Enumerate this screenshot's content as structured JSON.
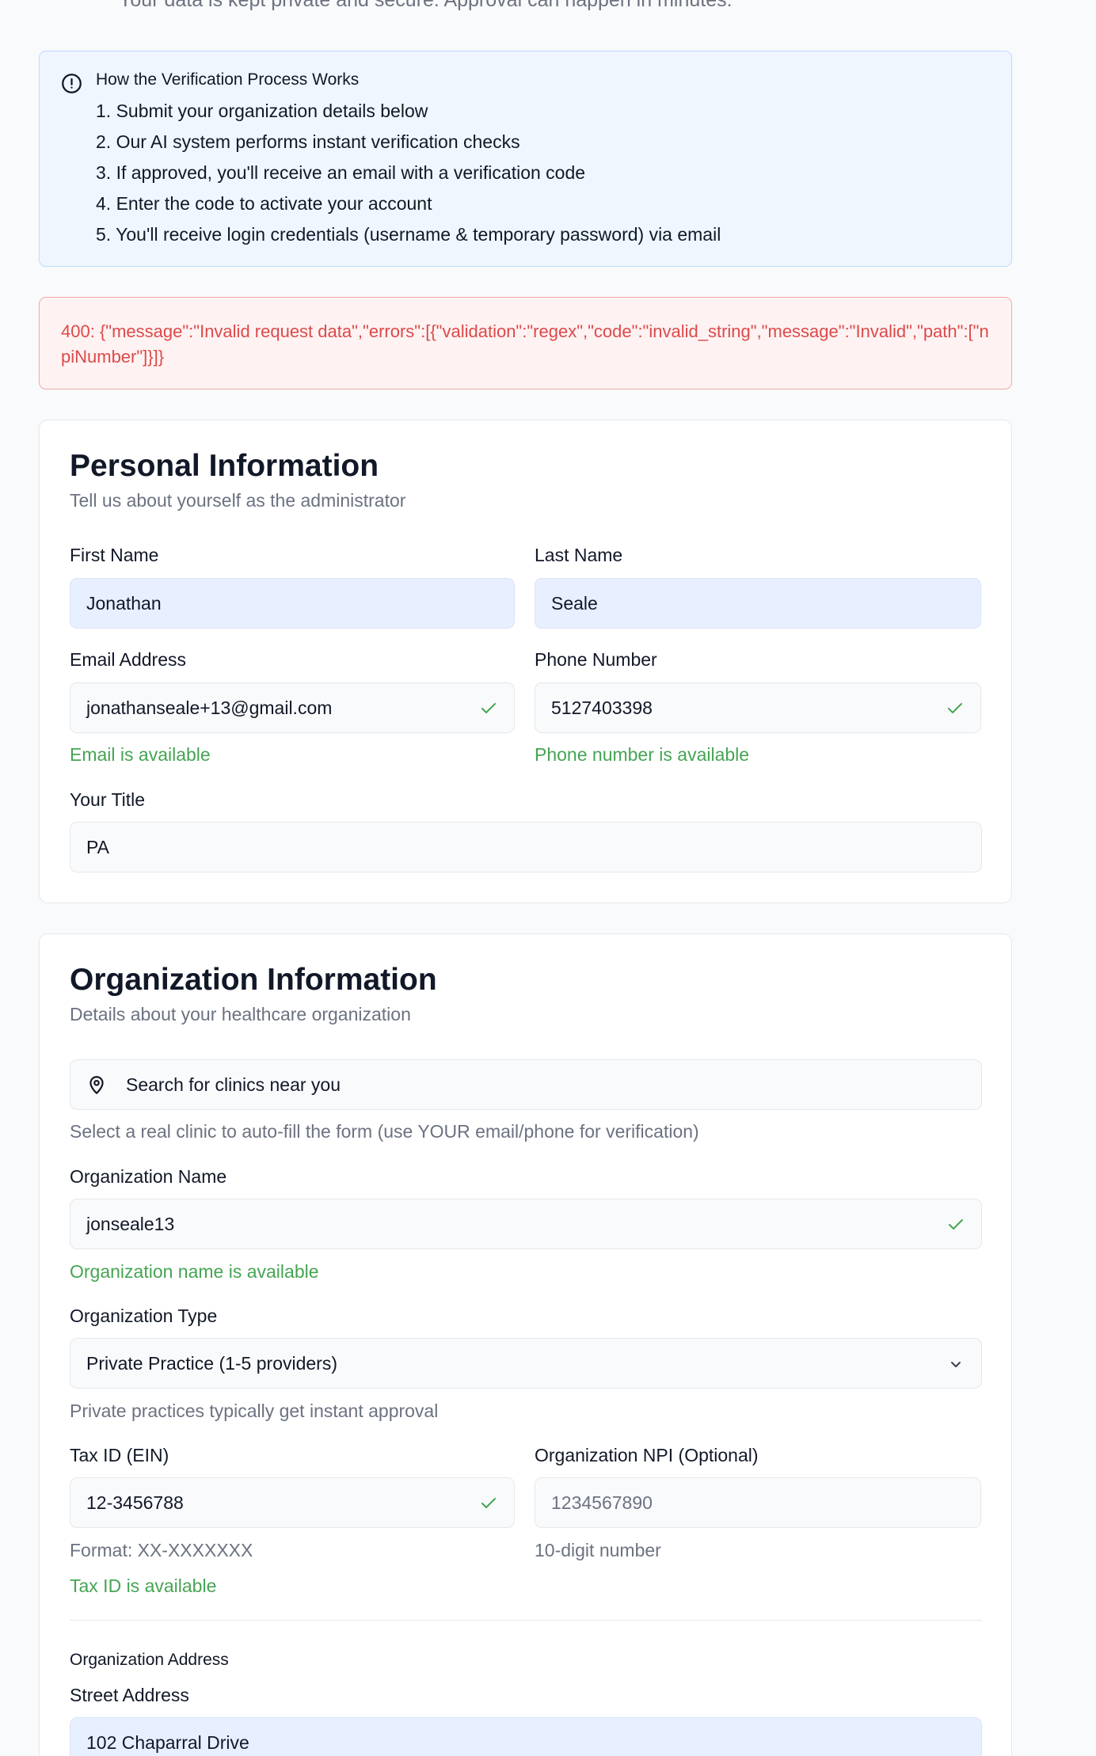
{
  "top_text": "Your data is kept private and secure. Approval can happen in minutes.",
  "process": {
    "title": "How the Verification Process Works",
    "steps": [
      "1. Submit your organization details below",
      "2. Our AI system performs instant verification checks",
      "3. If approved, you'll receive an email with a verification code",
      "4. Enter the code to activate your account",
      "5. You'll receive login credentials (username & temporary password) via email"
    ]
  },
  "error": {
    "message": "400: {\"message\":\"Invalid request data\",\"errors\":[{\"validation\":\"regex\",\"code\":\"invalid_string\",\"message\":\"Invalid\",\"path\":[\"npiNumber\"]}]}"
  },
  "personal": {
    "title": "Personal Information",
    "subtitle": "Tell us about yourself as the administrator",
    "first_name": {
      "label": "First Name",
      "value": "Jonathan"
    },
    "last_name": {
      "label": "Last Name",
      "value": "Seale"
    },
    "email": {
      "label": "Email Address",
      "value": "jonathanseale+13@gmail.com",
      "status": "Email is available"
    },
    "phone": {
      "label": "Phone Number",
      "value": "5127403398",
      "status": "Phone number is available"
    },
    "title_field": {
      "label": "Your Title",
      "value": "PA"
    }
  },
  "organization": {
    "title": "Organization Information",
    "subtitle": "Details about your healthcare organization",
    "search": {
      "placeholder": "Search for clinics near you",
      "hint": "Select a real clinic to auto-fill the form (use YOUR email/phone for verification)"
    },
    "name": {
      "label": "Organization Name",
      "value": "jonseale13",
      "status": "Organization name is available"
    },
    "type": {
      "label": "Organization Type",
      "value": "Private Practice (1-5 providers)",
      "hint": "Private practices typically get instant approval"
    },
    "tax_id": {
      "label": "Tax ID (EIN)",
      "value": "12-3456788",
      "hint": "Format: XX-XXXXXXX",
      "status": "Tax ID is available"
    },
    "npi": {
      "label": "Organization NPI (Optional)",
      "placeholder": "1234567890",
      "hint": "10-digit number"
    },
    "address_heading": "Organization Address",
    "street": {
      "label": "Street Address",
      "value": "102 Chaparral Drive"
    }
  },
  "colors": {
    "success": "#46a454",
    "error": "#dc4a4a",
    "info_bg": "#eff6ff",
    "filled_bg": "#e8efff"
  }
}
